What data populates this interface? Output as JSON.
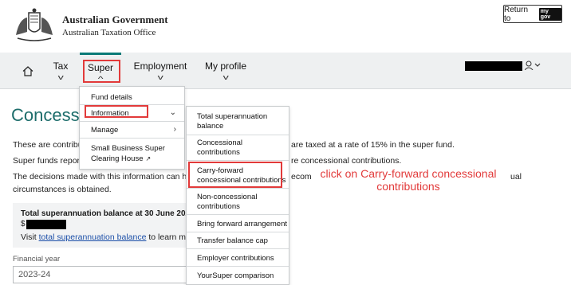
{
  "header": {
    "gov_line1": "Australian Government",
    "gov_line2": "Australian Taxation Office",
    "return_label": "Return to",
    "mygov_badge": "my gov"
  },
  "nav": {
    "home_icon": "home-icon",
    "items": [
      {
        "label": "Tax"
      },
      {
        "label": "Super"
      },
      {
        "label": "Employment"
      },
      {
        "label": "My profile"
      }
    ]
  },
  "main": {
    "title": "Concessi",
    "para1_left": "These are contribu",
    "para1_right": "are taxed at a rate of 15% in the super fund.",
    "para2_left": "Super funds repor",
    "para2_right": "re concessional contributions.",
    "para3_left": "The decisions made with this information can h",
    "para3_mid": "ecom",
    "para3_right": "ual",
    "para4_left": "circumstances is obtained.",
    "balance_title": "Total superannuation balance at 30 June 2023",
    "dollar_sign": "$",
    "visit_prefix": "Visit",
    "visit_link": "total superannuation balance",
    "visit_suffix": "to learn mo",
    "fy_label": "Financial year",
    "fy_value": "2023-24"
  },
  "super_menu": {
    "items": [
      {
        "label": "Fund details"
      },
      {
        "label": "Information"
      },
      {
        "label": "Manage"
      },
      {
        "label": "Small Business Super"
      },
      {
        "label": "Clearing House"
      }
    ]
  },
  "info_submenu": {
    "items": [
      {
        "line1": "Total superannuation",
        "line2": "balance"
      },
      {
        "line1": "Concessional",
        "line2": "contributions"
      },
      {
        "line1": "Carry-forward",
        "line2": "concessional contributions"
      },
      {
        "line1": "Non-concessional",
        "line2": "contributions"
      },
      {
        "line1": "Bring forward arrangement"
      },
      {
        "line1": "Transfer balance cap"
      },
      {
        "line1": "Employer contributions"
      },
      {
        "line1": "YourSuper comparison"
      }
    ]
  },
  "annotation": {
    "line1": "click on Carry-forward concessional",
    "line2": "contributions",
    "color": "#e23a3a"
  },
  "colors": {
    "accent": "#0b7a77",
    "title": "#1d6d6b",
    "link": "#1c4fa8"
  }
}
